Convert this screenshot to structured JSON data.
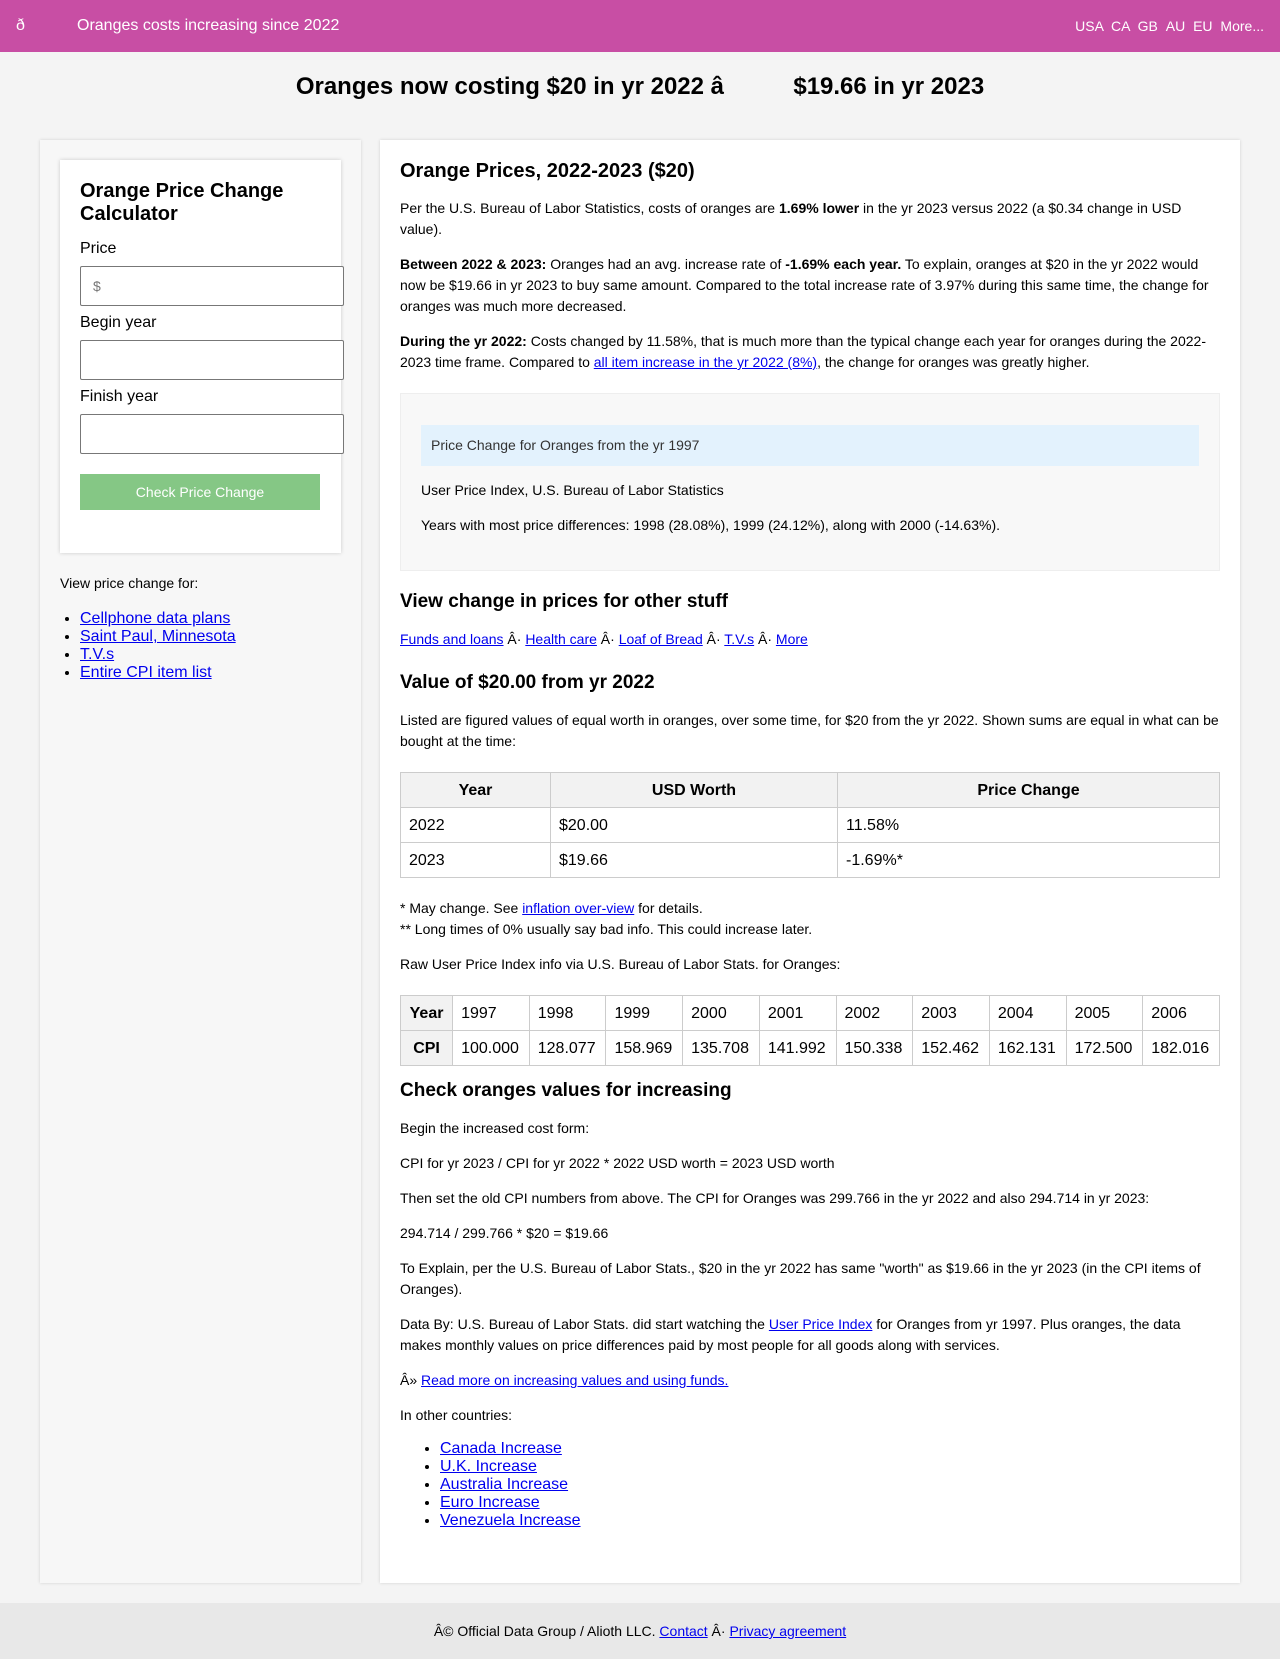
{
  "header": {
    "logo": "ð",
    "site_title": "Oranges costs increasing since 2022",
    "countries": [
      "USA",
      "CA",
      "GB",
      "AU",
      "EU",
      "More..."
    ]
  },
  "page_heading": {
    "part1": "Oranges now costing $20 in yr 2022 â",
    "part2": "$19.66 in yr 2023"
  },
  "calculator": {
    "title": "Orange Price Change Calculator",
    "price_label": "Price",
    "price_placeholder": "$",
    "begin_label": "Begin year",
    "finish_label": "Finish year",
    "button": "Check Price Change"
  },
  "sidebar": {
    "view_for": "View price change for:",
    "links": [
      "Cellphone data plans",
      "Saint Paul, Minnesota",
      "T.V.s",
      "Entire CPI item list"
    ]
  },
  "main": {
    "title": "Orange Prices, 2022-2023 ($20)",
    "p1": {
      "a": "Per the U.S. Bureau of Labor Statistics, costs of oranges are ",
      "b": "1.69% lower",
      "c": " in the yr 2023 versus 2022 (a $0.34 change in USD value)."
    },
    "p2": {
      "a": "Between 2022 & 2023:",
      "b": " Oranges had an avg. increase rate of ",
      "c": "-1.69% each year.",
      "d": " To explain, oranges at $20 in the yr 2022 would now be $19.66 in yr 2023 to buy same amount. Compared to the total increase rate of 3.97% during this same time, the change for oranges was much more decreased."
    },
    "p3": {
      "a": "During the yr 2022:",
      "b": " Costs changed by 11.58%, that is much more than the typical change each year for oranges during the 2022-2023 time frame. Compared to ",
      "link": "all item increase in the yr 2022 (8%)",
      "c": ", the change for oranges was greatly higher."
    },
    "infobox": {
      "banner": "Price Change for Oranges from the yr 1997",
      "source": "User Price Index, U.S. Bureau of Labor Statistics",
      "most_diff": "Years with most price differences: 1998 (28.08%), 1999 (24.12%), along with 2000 (-14.63%)."
    },
    "other_stuff": {
      "title": "View change in prices for other stuff",
      "links": [
        "Funds and loans",
        "Health care",
        "Loaf of Bread",
        "T.V.s",
        "More"
      ],
      "separator": " Â· "
    },
    "value_section": {
      "title": "Value of $20.00 from yr 2022",
      "text": "Listed are figured values of equal worth in oranges, over some time, for $20 from the yr 2022. Shown sums are equal in what can be bought at the time:",
      "headers": [
        "Year",
        "USD Worth",
        "Price Change"
      ],
      "rows": [
        [
          "2022",
          "$20.00",
          "11.58%"
        ],
        [
          "2023",
          "$19.66",
          "-1.69%*"
        ]
      ]
    },
    "notes": {
      "n1a": "* May change. See ",
      "n1link": "inflation over-view",
      "n1b": " for details.",
      "n2": "** Long times of 0% usually say bad info. This could increase later."
    },
    "raw_cpi": {
      "text": "Raw User Price Index info via U.S. Bureau of Labor Stats. for Oranges:",
      "year_label": "Year",
      "cpi_label": "CPI",
      "years": [
        "1997",
        "1998",
        "1999",
        "2000",
        "2001",
        "2002",
        "2003",
        "2004",
        "2005",
        "2006"
      ],
      "values": [
        "100.000",
        "128.077",
        "158.969",
        "135.708",
        "141.992",
        "150.338",
        "152.462",
        "162.131",
        "172.500",
        "182.016"
      ]
    },
    "check": {
      "title": "Check oranges values for increasing",
      "begin": "Begin the increased cost form:",
      "formula": "CPI for yr 2023 / CPI for yr 2022 * 2022 USD worth = 2023 USD worth",
      "then": "Then set the old CPI numbers from above. The CPI for Oranges was 299.766 in the yr 2022 and also 294.714 in yr 2023:",
      "calc": "294.714 / 299.766 * $20 = $19.66",
      "explain": "To Explain, per the U.S. Bureau of Labor Stats., $20 in the yr 2022 has same \"worth\" as $19.66 in the yr 2023 (in the CPI items of Oranges).",
      "data_by_a": "Data By: U.S. Bureau of Labor Stats. did start watching the ",
      "data_by_link": "User Price Index",
      "data_by_b": " for Oranges from yr 1997. Plus oranges, the data makes monthly values on price differences paid by most people for all goods along with services.",
      "read_more_prefix": "Â» ",
      "read_more_link": "Read more on increasing values and using funds.",
      "other_countries": "In other countries:",
      "country_links": [
        "Canada Increase",
        "U.K. Increase",
        "Australia Increase",
        "Euro Increase",
        "Venezuela Increase"
      ]
    }
  },
  "footer": {
    "text": "Â© Official Data Group / Alioth LLC. ",
    "contact": "Contact",
    "sep": " Â· ",
    "privacy": "Privacy agreement"
  }
}
